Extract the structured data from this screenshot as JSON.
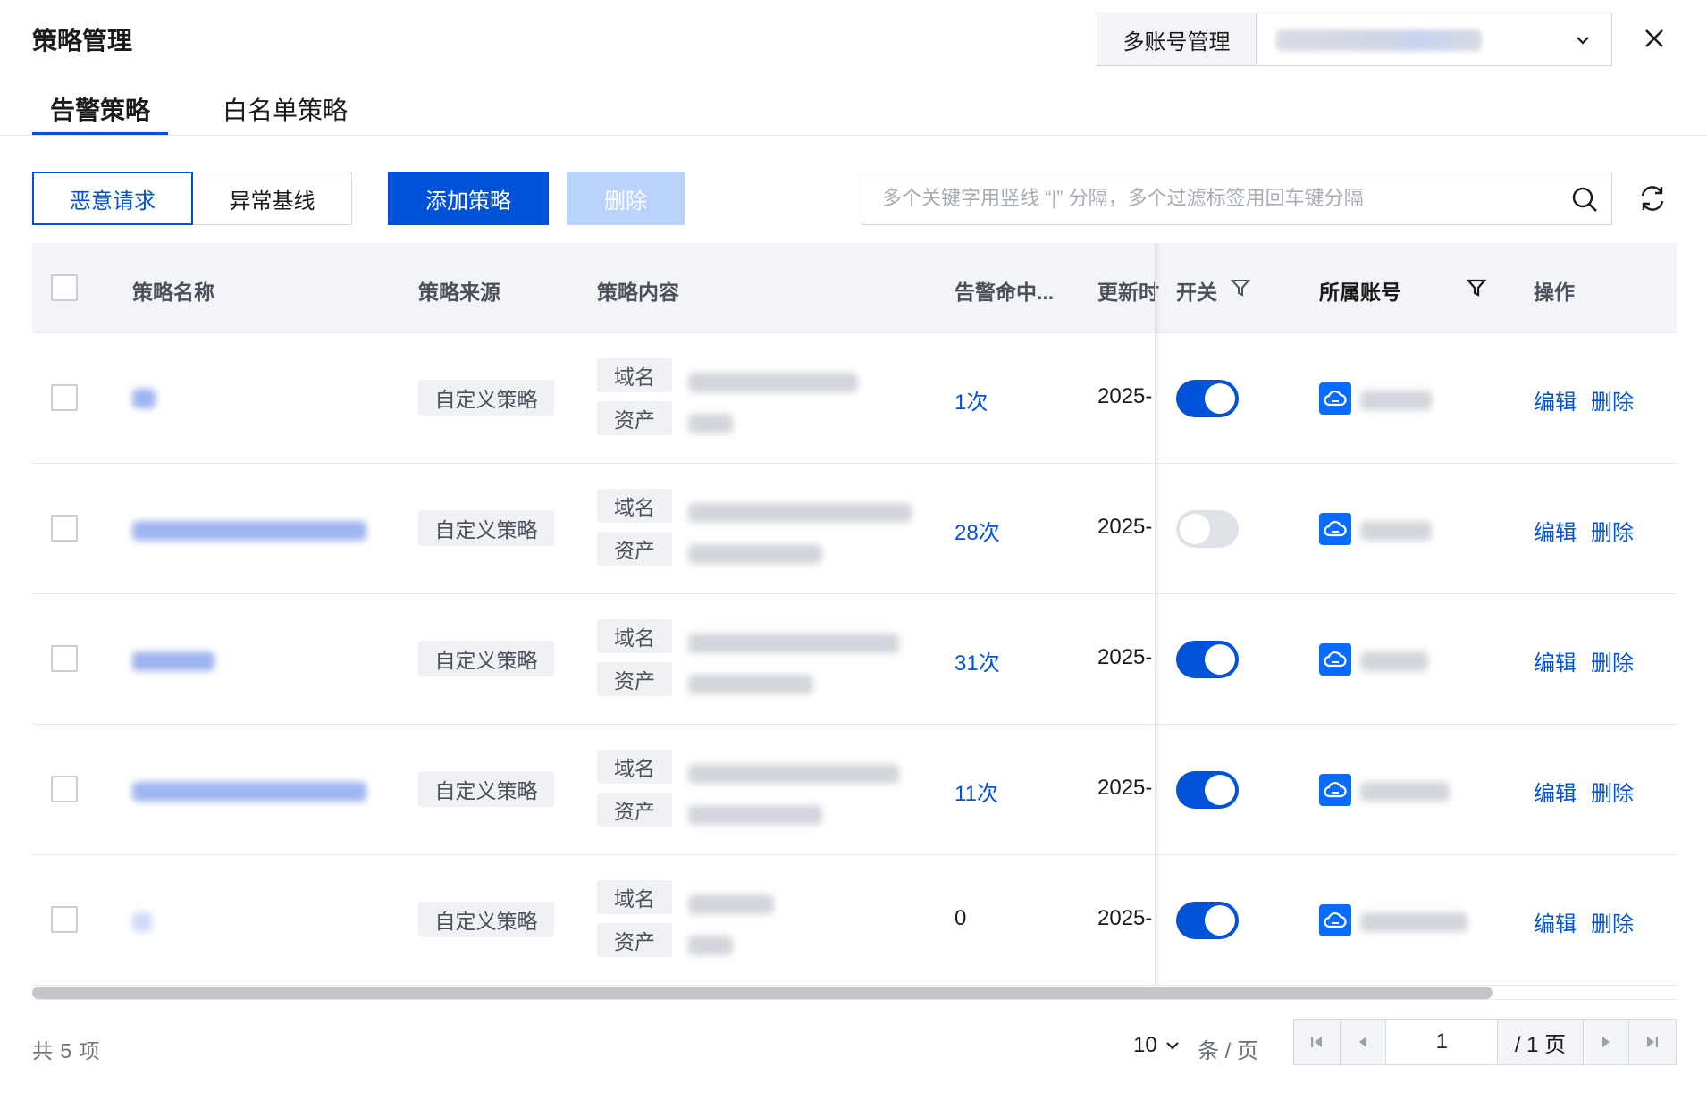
{
  "header": {
    "title": "策略管理",
    "multi_account_label": "多账号管理",
    "close_icon": "close-icon"
  },
  "tabs": [
    {
      "label": "告警策略",
      "active": true
    },
    {
      "label": "白名单策略",
      "active": false
    }
  ],
  "toolbar": {
    "segments": [
      {
        "label": "恶意请求",
        "active": true
      },
      {
        "label": "异常基线",
        "active": false
      }
    ],
    "add_label": "添加策略",
    "delete_label": "删除",
    "search_placeholder": "多个关键字用竖线 “|” 分隔，多个过滤标签用回车键分隔"
  },
  "table": {
    "columns": [
      "策略名称",
      "策略来源",
      "策略内容",
      "告警命中...",
      "更新时",
      "开关",
      "所属账号",
      "操作"
    ],
    "rows": [
      {
        "source": "自定义策略",
        "content_tags": [
          "域名",
          "资产"
        ],
        "hits": "1次",
        "updated": "2025-",
        "enabled": true,
        "actions": [
          "编辑",
          "删除"
        ]
      },
      {
        "source": "自定义策略",
        "content_tags": [
          "域名",
          "资产"
        ],
        "hits": "28次",
        "updated": "2025-",
        "enabled": false,
        "actions": [
          "编辑",
          "删除"
        ]
      },
      {
        "source": "自定义策略",
        "content_tags": [
          "域名",
          "资产"
        ],
        "hits": "31次",
        "updated": "2025-",
        "enabled": true,
        "actions": [
          "编辑",
          "删除"
        ]
      },
      {
        "source": "自定义策略",
        "content_tags": [
          "域名",
          "资产"
        ],
        "hits": "11次",
        "updated": "2025-",
        "enabled": true,
        "actions": [
          "编辑",
          "删除"
        ]
      },
      {
        "source": "自定义策略",
        "content_tags": [
          "域名",
          "资产"
        ],
        "hits": "0",
        "updated": "2025-",
        "enabled": true,
        "actions": [
          "编辑",
          "删除"
        ]
      }
    ]
  },
  "pagination": {
    "total": "共 5 项",
    "page_size": "10",
    "page_size_unit": "条 / 页",
    "current_page": "1",
    "total_pages": "/ 1 页"
  },
  "colors": {
    "primary": "#0052d9",
    "disabled_primary": "#bbd3fb",
    "header_bg": "#f3f4f7"
  }
}
